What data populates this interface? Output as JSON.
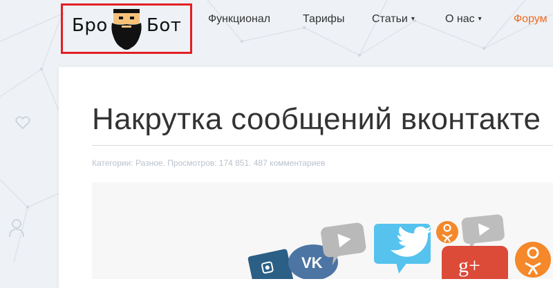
{
  "brand": {
    "left_word": "Бро",
    "right_word": "Бот",
    "logo_icon": "bearded-bot-face-icon",
    "highlight_color": "#e31e24"
  },
  "nav": {
    "items": [
      {
        "label": "Функционал",
        "dropdown": false
      },
      {
        "label": "Тарифы",
        "dropdown": false
      },
      {
        "label": "Статьи",
        "dropdown": true
      },
      {
        "label": "О нас",
        "dropdown": true
      },
      {
        "label": "Форум",
        "dropdown": false
      }
    ],
    "caret": "▾",
    "accent_color": "#ef6c23"
  },
  "sidebar": {
    "icons": [
      "heart-icon",
      "user-icon"
    ]
  },
  "article": {
    "title": "Накрутка сообщений вконтакте",
    "meta": "Категории: Разное. Просмотров: 174 851. 487 комментариев"
  },
  "hero": {
    "icons": [
      "instagram-icon",
      "vk-icon",
      "youtube-icon",
      "twitter-icon",
      "odnoklassniki-icon",
      "youtube-icon",
      "google-plus-icon",
      "odnoklassniki-icon"
    ],
    "gplus_text": "g+",
    "vk_text": "VK"
  }
}
